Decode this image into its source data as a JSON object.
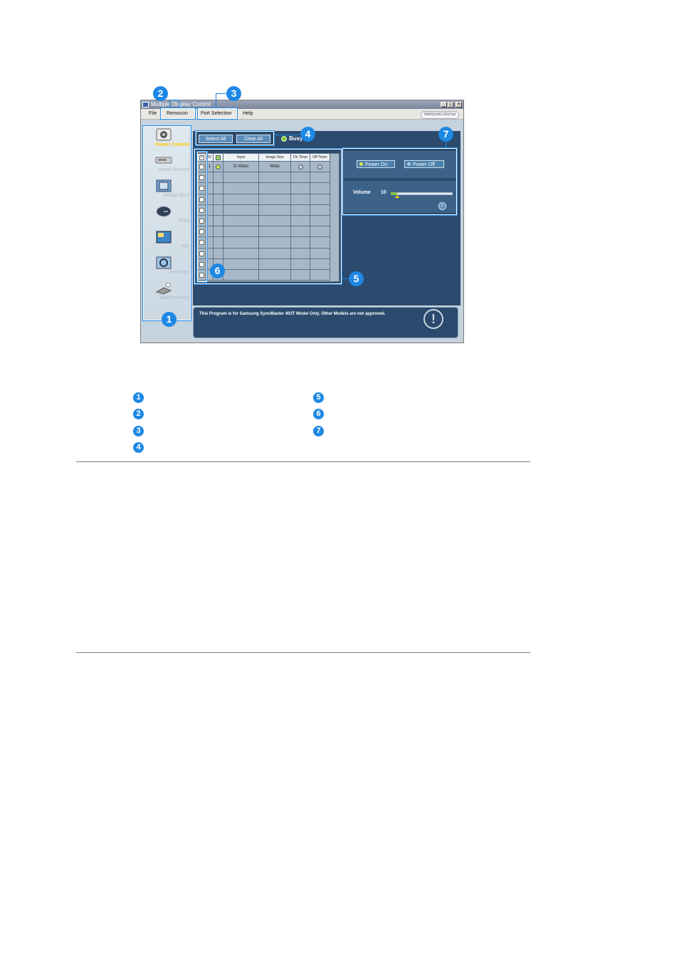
{
  "window": {
    "title": "Multiple Display Control",
    "controls": {
      "minimize": "_",
      "maximize": "□",
      "close": "×"
    }
  },
  "menu": {
    "items": [
      "File",
      "Remocon",
      "Port Selection",
      "Help"
    ],
    "brand": "SAMSUNG DIGITall"
  },
  "nav": {
    "items": [
      {
        "label": "Power Control",
        "icon": "power-control-icon",
        "active": true
      },
      {
        "label": "Input Source",
        "icon": "input-source-icon"
      },
      {
        "label": "Image Size",
        "icon": "image-size-icon"
      },
      {
        "label": "Time",
        "icon": "time-icon"
      },
      {
        "label": "PIP",
        "icon": "pip-icon"
      },
      {
        "label": "Settings",
        "icon": "settings-icon"
      },
      {
        "label": "Maintenance",
        "icon": "maintenance-icon"
      }
    ]
  },
  "toolbar": {
    "select_all": "Select All",
    "clear_all": "Clear All",
    "busy": "Busy"
  },
  "grid": {
    "headers": [
      "",
      "ID",
      "",
      "Input",
      "Image Size",
      "On Timer",
      "Off Timer"
    ],
    "rows": [
      {
        "id": "1",
        "input": "S-Video",
        "image_size": "Wide",
        "on_timer": "off",
        "off_timer": "off",
        "status": "on"
      }
    ],
    "empty_rows": 10
  },
  "control": {
    "power_on": "Power On",
    "power_off": "Power Off",
    "volume_label": "Volume",
    "volume_value": "10",
    "volume_fraction": 0.1
  },
  "notice": "This Program is for Samsung SyncMaster 403T Model Only. Other Models are not approved.",
  "callouts": [
    "1",
    "2",
    "3",
    "4",
    "5",
    "6",
    "7"
  ],
  "legend": {
    "left": [
      "1",
      "2",
      "3",
      "4"
    ],
    "right": [
      "5",
      "6",
      "7"
    ]
  },
  "colors": {
    "callout": "#1e88e5",
    "panel": "#2b4a6d",
    "nav_active": "#ffcc00",
    "busy_led": "#7ccf3c"
  }
}
